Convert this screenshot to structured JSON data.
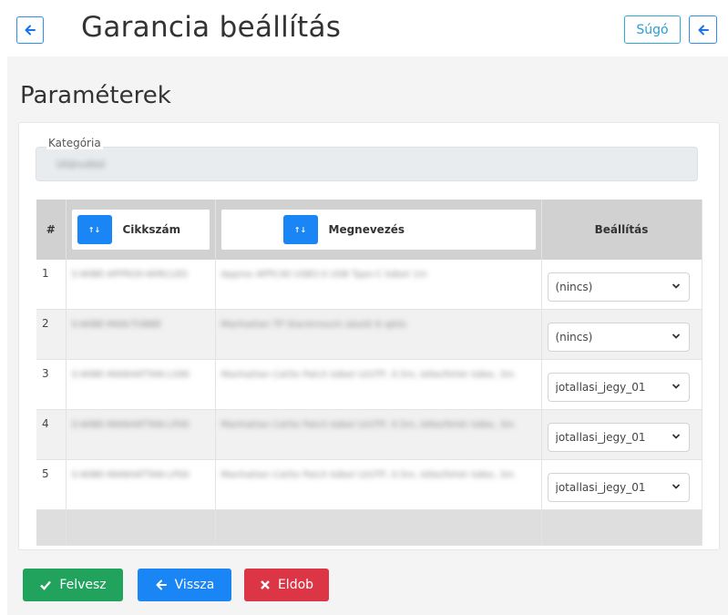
{
  "header": {
    "title": "Garancia beállítás",
    "help_label": "Súgó",
    "back_icon": "arrow-left-icon"
  },
  "section": {
    "title": "Paraméterek"
  },
  "category": {
    "legend": "Kategória",
    "value": "Utánvétel"
  },
  "table": {
    "col_index": "#",
    "col_sku": "Cikkszám",
    "col_name": "Megnevezés",
    "col_setting": "Beállítás",
    "sort_icon": "↑↓",
    "rows": [
      {
        "index": "1",
        "sku": "S-WIBE-APPROX-WIRCLED",
        "name": "Approx APPC40 USB3.0 USB Type-C kábel 1m",
        "setting": "(nincs)"
      },
      {
        "index": "2",
        "sku": "S-WIBE-MAN-TOBBE",
        "name": "Manhattan TP Stackmount zászló 6 ajtós",
        "setting": "(nincs)"
      },
      {
        "index": "3",
        "sku": "S-WIBE-MANHATTAN-LS90",
        "name": "Manhattan Cat5e Patch kábel U/UTP, 0.5m, kéke/fehér kábe, 3m",
        "setting": "jotallasi_jegy_01"
      },
      {
        "index": "4",
        "sku": "S-WIBE-MANHATTAN-LP00",
        "name": "Manhattan Cat5e Patch kábel U/UTP, 0.5m, kéke/fehér kábe, 3m",
        "setting": "jotallasi_jegy_01"
      },
      {
        "index": "5",
        "sku": "S-WIBE-MANHATTAN-LP00",
        "name": "Manhattan Cat5e Patch kábel U/UTP, 0.5m, kéke/fehér kábe, 3m",
        "setting": "jotallasi_jegy_01"
      }
    ]
  },
  "actions": {
    "save_label": "Felvesz",
    "back_label": "Vissza",
    "discard_label": "Eldob"
  },
  "colors": {
    "primary": "#1a86f5",
    "success": "#22a35d",
    "danger": "#dc3545",
    "info": "#2ba8d8"
  }
}
